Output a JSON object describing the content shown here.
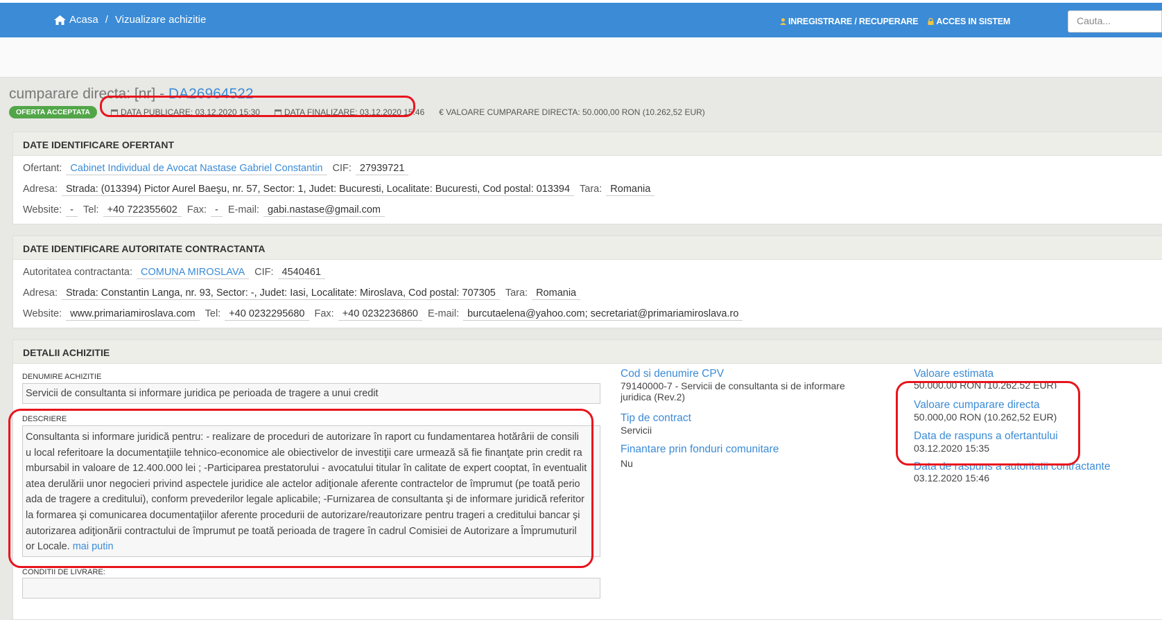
{
  "topbar": {
    "home": "Acasa",
    "separator": "/",
    "current": "Vizualizare achizitie",
    "register": "INREGISTRARE / RECUPERARE",
    "login": "ACCES IN SISTEM",
    "search_placeholder": "Cauta..."
  },
  "header": {
    "title_prefix": "cumparare directa: [nr] - ",
    "code": "DA26964522",
    "status": "OFERTA ACCEPTATA",
    "published": "DATA PUBLICARE: 03.12.2020 15:30",
    "finalized": "DATA FINALIZARE: 03.12.2020 15:46",
    "value": "€ VALOARE CUMPARARE DIRECTA: 50.000,00  RON (10.262,52  EUR)"
  },
  "ofertant": {
    "title": "DATE IDENTIFICARE OFERTANT",
    "name_label": "Ofertant:",
    "name": "Cabinet Individual de Avocat Nastase Gabriel Constantin",
    "cif_label": "CIF:",
    "cif": "27939721",
    "address_label": "Adresa:",
    "address": "Strada: (013394) Pictor Aurel Baeşu, nr. 57, Sector: 1, Judet: Bucuresti, Localitate: Bucuresti, Cod postal: 013394",
    "country_label": "Tara:",
    "country": "Romania",
    "website_label": "Website:",
    "website": "-",
    "tel_label": "Tel:",
    "tel": "+40 722355602",
    "fax_label": "Fax:",
    "fax": "-",
    "email_label": "E-mail:",
    "email": "gabi.nastase@gmail.com"
  },
  "autoritate": {
    "title": "DATE IDENTIFICARE AUTORITATE CONTRACTANTA",
    "name_label": "Autoritatea contractanta:",
    "name": "COMUNA MIROSLAVA",
    "cif_label": "CIF:",
    "cif": "4540461",
    "address_label": "Adresa:",
    "address": "Strada: Constantin Langa, nr. 93, Sector: -, Judet: Iasi, Localitate: Miroslava, Cod postal: 707305",
    "country_label": "Tara:",
    "country": "Romania",
    "website_label": "Website:",
    "website": "www.primariamiroslava.com",
    "tel_label": "Tel:",
    "tel": "+40 0232295680",
    "fax_label": "Fax:",
    "fax": "+40 0232236860",
    "email_label": "E-mail:",
    "email": "burcutaelena@yahoo.com; secretariat@primariamiroslava.ro"
  },
  "detalii": {
    "title": "DETALII ACHIZITIE",
    "denumire_label": "DENUMIRE ACHIZITIE",
    "denumire": "Servicii de consultanta si informare juridica pe perioada de tragere a unui credit",
    "descriere_label": "DESCRIERE",
    "descriere_lines": [
      "Consultanta si informare juridică pentru: - realizare de proceduri de autorizare în raport cu fundamentarea hotărârii de consili",
      "u local referitoare la documentaţiile tehnico-economice ale obiectivelor de investiţii care urmează să fie finanţate prin credit ra",
      "mbursabil in valoare de 12.400.000 lei ; -Participarea prestatorului - avocatului titular în calitate de expert cooptat, în eventualit",
      "atea derulării unor negocieri privind aspectele juridice ale actelor adiţionale aferente contractelor de împrumut (pe toată perio",
      "ada de tragere a creditului), conform prevederilor legale aplicabile; -Furnizarea de consultanta şi de informare juridică referitor",
      "la formarea şi comunicarea documentaţiilor aferente procedurii de autorizare/reautorizare pentru trageri a creditului bancar şi",
      "autorizarea adiţionării contractului de împrumut pe toată perioada de tragere în cadrul Comisiei de Autorizare a Împrumuturil"
    ],
    "descriere_last": "or Locale. ",
    "mai_putin": "mai putin",
    "conditii_label": "CONDITII DE LIVRARE:",
    "cpv_label": "Cod si denumire CPV",
    "cpv_line1": "79140000-7 - Servicii de consultanta si de informare",
    "cpv_line2": "juridica (Rev.2)",
    "tip_label": "Tip de contract",
    "tip": "Servicii",
    "fonduri_label": "Finantare prin fonduri comunitare",
    "fonduri": "Nu",
    "val_est_label": "Valoare estimata",
    "val_est": "50.000,00  RON (10.262,52  EUR)",
    "val_cd_label": "Valoare cumparare directa",
    "val_cd": "50.000,00  RON (10.262,52  EUR)",
    "raspuns_ofertant_label": "Data de raspuns a ofertantului",
    "raspuns_ofertant": "03.12.2020 15:35",
    "raspuns_autoritate_label": "Data de raspuns a autoritatii contractante",
    "raspuns_autoritate": "03.12.2020 15:46"
  }
}
